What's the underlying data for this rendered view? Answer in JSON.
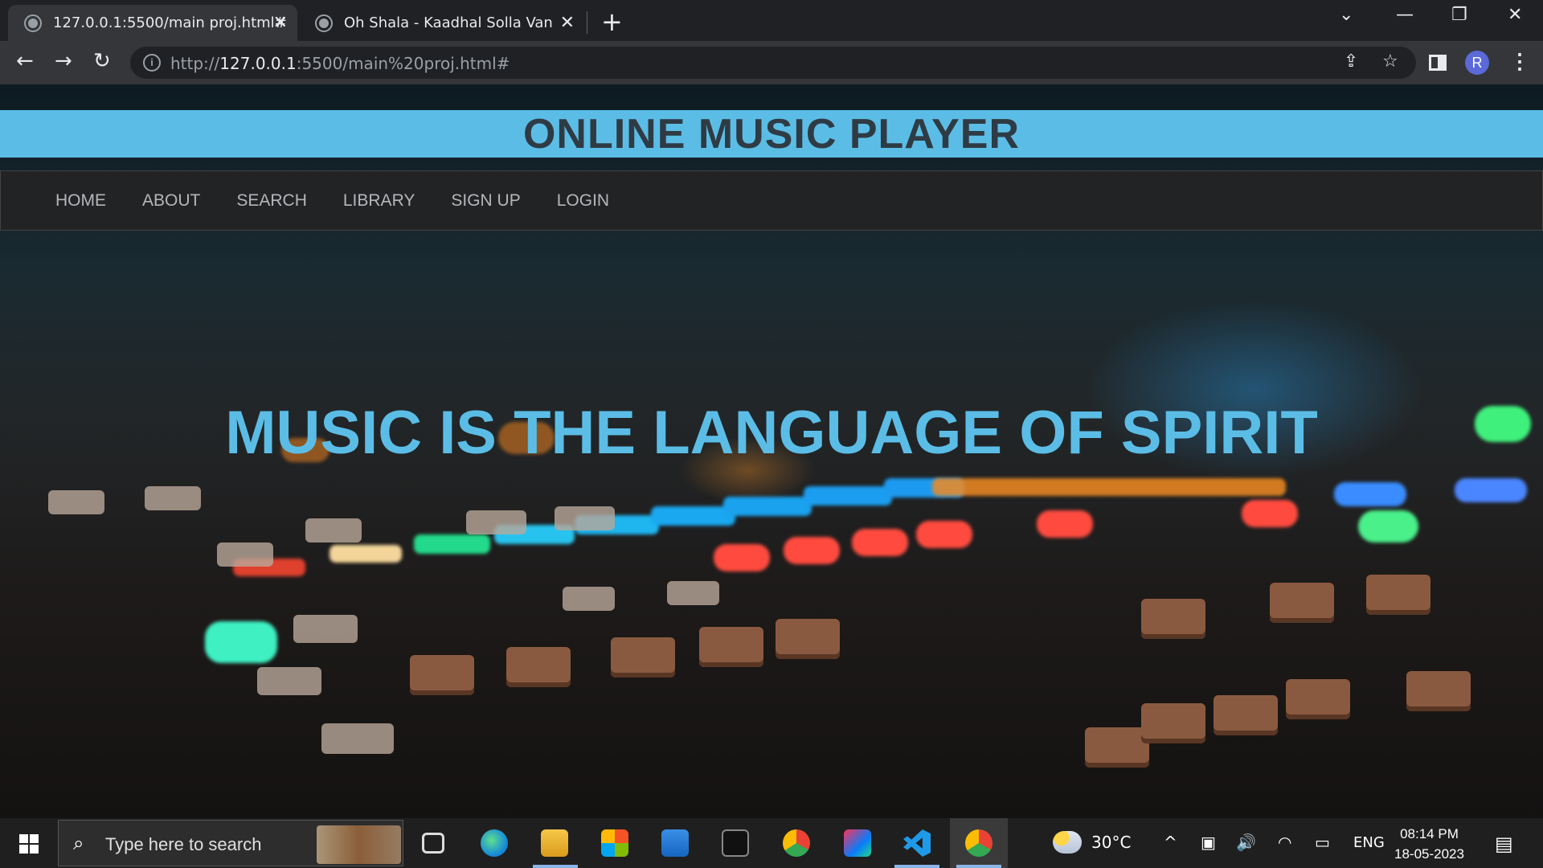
{
  "browser": {
    "tabs": [
      {
        "title": "127.0.0.1:5500/main proj.html#",
        "active": true
      },
      {
        "title": "Oh Shala - Kaadhal Solla Vandhe",
        "active": false
      }
    ],
    "new_tab": "+",
    "window_controls": {
      "minimize": "—",
      "restore": "❐",
      "close": "✕",
      "tab_search": "⌄"
    },
    "nav": {
      "back": "←",
      "forward": "→",
      "reload": "↻"
    },
    "url_prefix": "http://",
    "url_host": "127.0.0.1",
    "url_rest": ":5500/main%20proj.html#",
    "profile_initial": "R",
    "icons": {
      "site_info": "i",
      "share": "⇪",
      "bookmark": "☆",
      "menu": "⋮"
    }
  },
  "site": {
    "title": "ONLINE MUSIC PLAYER",
    "nav": [
      "HOME",
      "ABOUT",
      "SEARCH",
      "LIBRARY",
      "SIGN UP",
      "LOGIN"
    ],
    "tagline": "MUSIC IS THE LANGUAGE OF SPIRIT",
    "colors": {
      "accent": "#5bbde6",
      "nav_bg": "#222325",
      "title_text": "#2f3b44"
    }
  },
  "taskbar": {
    "search_placeholder": "Type here to search",
    "search_icon": "⌕",
    "weather": "30°C",
    "language": "ENG",
    "time": "08:14 PM",
    "date": "18-05-2023",
    "tray_icons": {
      "chevron": "^",
      "meet": "▣",
      "volume": "🔊",
      "wifi": "◠",
      "battery": "▭",
      "notifications": "▤"
    }
  }
}
